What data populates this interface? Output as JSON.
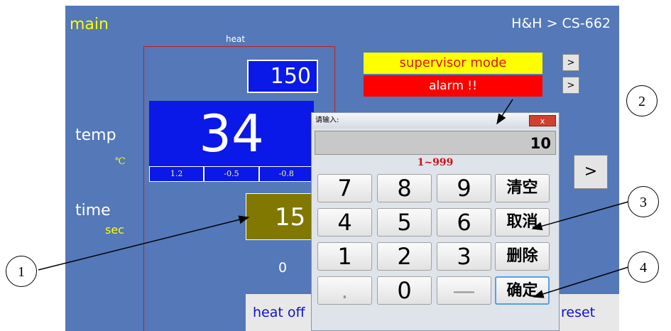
{
  "screen": {
    "title": "main",
    "breadcrumb": "H&H > CS-662",
    "heat_label": "heat",
    "temp_label": "temp",
    "temp_unit": "℃",
    "time_label": "time",
    "time_unit": "sec",
    "setpoint": "150",
    "current_temp": "34",
    "sub_values": [
      "1.2",
      "-0.5",
      "-0.8"
    ],
    "time_value": "15",
    "zero_value": "0",
    "supervisor_mode": "supervisor mode",
    "alarm": "alarm !!",
    "small_button_label": ">",
    "nav_button_label": ">",
    "heat_off": "heat off",
    "reset": "reset"
  },
  "keypad": {
    "title": "请输入:",
    "close_label": "x",
    "display_value": "10",
    "range": "1~999",
    "keys": [
      [
        "7",
        "8",
        "9",
        "清空"
      ],
      [
        "4",
        "5",
        "6",
        "取消"
      ],
      [
        "1",
        "2",
        "3",
        "删除"
      ],
      [
        ".",
        "0",
        "—",
        "确定"
      ]
    ]
  },
  "callouts": [
    "1",
    "2",
    "3",
    "4"
  ],
  "colors": {
    "background": "#5478b8",
    "setpoint_box": "#0a18e8",
    "time_box": "#807800",
    "supervisor_bg": "#ffff00",
    "alarm_bg": "#ff0000"
  }
}
